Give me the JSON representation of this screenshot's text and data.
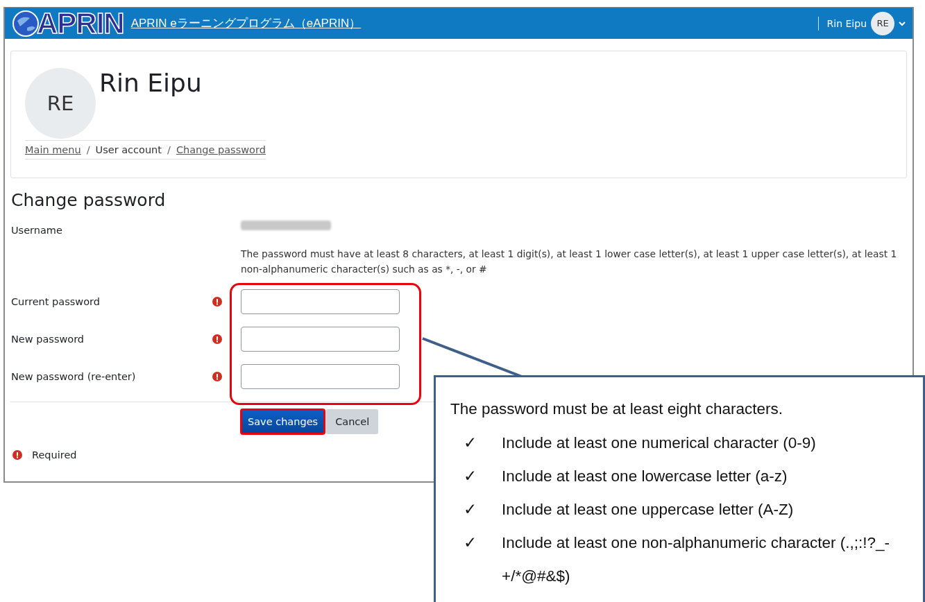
{
  "header": {
    "logo": "APRIN",
    "site_link": "APRIN eラーニングプログラム（eAPRIN）",
    "user_name": "Rin Eipu",
    "user_initials": "RE"
  },
  "profile": {
    "initials": "RE",
    "name": "Rin Eipu",
    "separator": "/",
    "breadcrumb": [
      {
        "label": "Main menu",
        "kind": "link"
      },
      {
        "label": "User account",
        "kind": "text"
      },
      {
        "label": "Change password",
        "kind": "link"
      }
    ]
  },
  "form": {
    "title": "Change password",
    "username_label": "Username",
    "policy": "The password must have at least 8 characters, at least 1 digit(s), at least 1 lower case letter(s), at least 1 upper case letter(s), at least 1 non-alphanumeric character(s) such as as *, -, or #",
    "fields": [
      {
        "label": "Current password",
        "required": true
      },
      {
        "label": "New password",
        "required": true
      },
      {
        "label": "New password (re-enter)",
        "required": true
      }
    ],
    "buttons": [
      {
        "label": "Save changes",
        "kind": "primary",
        "highlighted": true
      },
      {
        "label": "Cancel",
        "kind": "secondary",
        "highlighted": false
      }
    ],
    "required_note": "Required"
  },
  "callout": {
    "heading": "The password must be at least eight characters.",
    "items": [
      {
        "mark": "✓",
        "text": "Include at least one numerical character (0-9)"
      },
      {
        "mark": "✓",
        "text": "Include at least one lowercase letter (a-z)"
      },
      {
        "mark": "✓",
        "text": "Include at least one uppercase letter (A-Z)"
      },
      {
        "mark": "✓",
        "text": "Include at least one non-alphanumeric character (.,;:!?_-+/*@#&$)"
      }
    ]
  }
}
